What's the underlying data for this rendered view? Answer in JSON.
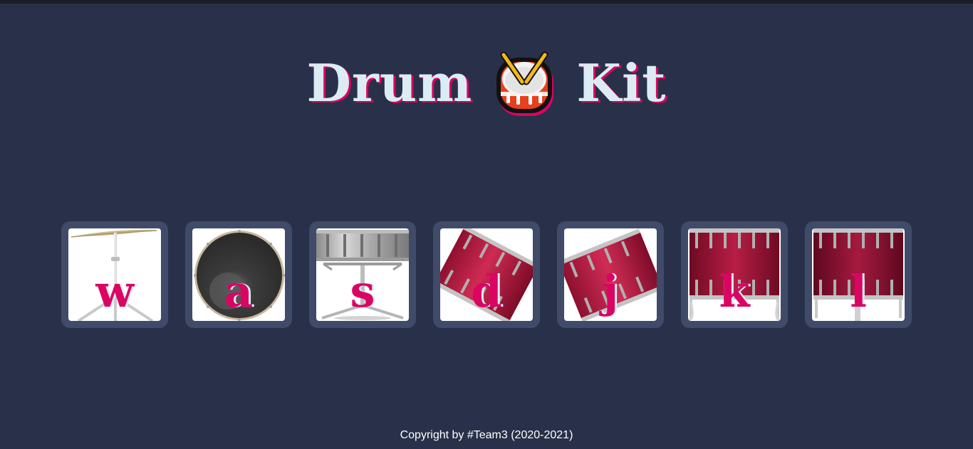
{
  "header": {
    "title_left": "Drum",
    "title_right": "Kit",
    "title_icon": "drum-emoji-icon"
  },
  "drums": [
    {
      "key": "w",
      "icon": "crash-cymbal-icon"
    },
    {
      "key": "a",
      "icon": "kick-drum-icon"
    },
    {
      "key": "s",
      "icon": "snare-drum-icon"
    },
    {
      "key": "d",
      "icon": "tom-1-icon"
    },
    {
      "key": "j",
      "icon": "tom-2-icon"
    },
    {
      "key": "k",
      "icon": "tom-3-icon"
    },
    {
      "key": "l",
      "icon": "tom-4-icon"
    }
  ],
  "footer": {
    "copyright": "Copyright by #Team3 (2020-2021)"
  },
  "colors": {
    "background": "#283149",
    "button_background": "#404b69",
    "title_text": "#dbedf3",
    "accent": "#da0463"
  }
}
